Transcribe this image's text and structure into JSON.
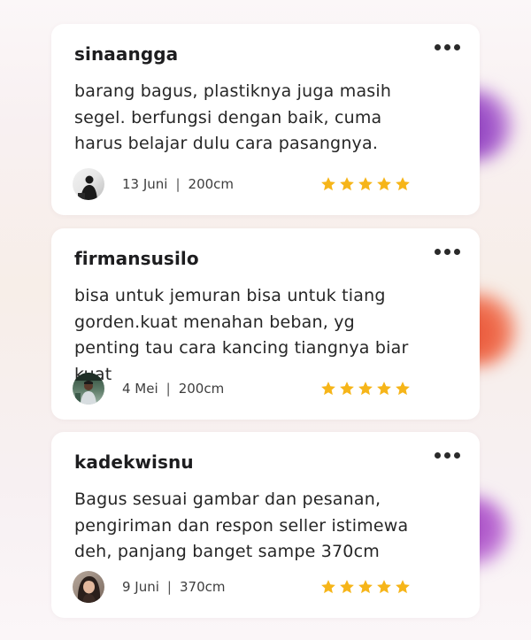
{
  "reviews": [
    {
      "username": "sinaangga",
      "text": "barang bagus, plastiknya juga masih segel. berfungsi dengan baik, cuma harus belajar dulu cara pasangnya.",
      "date": "13 Juni",
      "size": "200cm",
      "rating": 5,
      "avatar_icon": "avatar-silhouette-icon"
    },
    {
      "username": "firmansusilo",
      "text": "bisa untuk jemuran bisa untuk tiang gorden.kuat menahan beban, yg penting tau cara kancing tiangnya biar kuat",
      "date": "4 Mei",
      "size": "200cm",
      "rating": 5,
      "avatar_icon": "avatar-photo-icon"
    },
    {
      "username": "kadekwisnu",
      "text": "Bagus sesuai gambar dan pesanan, pengiriman dan respon seller istimewa deh, panjang banget sampe 370cm",
      "date": "9 Juni",
      "size": "370cm",
      "rating": 5,
      "avatar_icon": "avatar-photo-icon"
    }
  ],
  "separator": "|",
  "more_icon": "more-horizontal-icon",
  "colors": {
    "star": "#f6b519",
    "card_background": "#ffffff",
    "text": "#262626",
    "blob_purple": "#9b4cc6",
    "blob_orange": "#ec6142",
    "blob_violet": "#b45fd0"
  }
}
